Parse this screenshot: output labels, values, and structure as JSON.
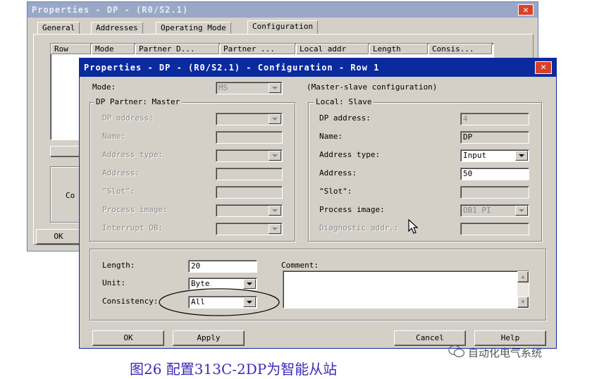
{
  "back_window": {
    "title": "Properties - DP - (R0/S2.1)",
    "tabs": [
      "General",
      "Addresses",
      "Operating Mode",
      "Configuration"
    ],
    "active_tab": "Configuration",
    "columns": [
      "Row",
      "Mode",
      "Partner D...",
      "Partner ...",
      "Local addr",
      "Length",
      "Consis..."
    ],
    "partial_label": "Co",
    "ok_label": "OK"
  },
  "dialog": {
    "title": "Properties - DP - (R0/S2.1) - Configuration - Row 1",
    "mode_label": "Mode:",
    "mode_value": "MS",
    "mode_description": "(Master-slave configuration)",
    "partner": {
      "group_label": "DP Partner: Master",
      "dp_address_label": "DP address:",
      "name_label": "Name:",
      "address_type_label": "Address type:",
      "address_label": "Address:",
      "slot_label": "\"Slot\":",
      "process_image_label": "Process image:",
      "interrupt_ob_label": "Interrupt OB:"
    },
    "local": {
      "group_label": "Local: Slave",
      "dp_address_label": "DP address:",
      "dp_address_value": "4",
      "name_label": "Name:",
      "name_value": "DP",
      "address_type_label": "Address type:",
      "address_type_value": "Input",
      "address_label": "Address:",
      "address_value": "50",
      "slot_label": "\"Slot\":",
      "process_image_label": "Process image:",
      "process_image_value": "OB1 PI",
      "diagnostic_label": "Diagnostic addr.:"
    },
    "length_label": "Length:",
    "length_value": "20",
    "unit_label": "Unit:",
    "unit_value": "Byte",
    "consistency_label": "Consistency:",
    "consistency_value": "All",
    "comment_label": "Comment:",
    "comment_value": "",
    "buttons": {
      "ok": "OK",
      "apply": "Apply",
      "cancel": "Cancel",
      "help": "Help"
    }
  },
  "caption": "图26   配置313C-2DP为智能从站",
  "watermark": "自动化电气系统"
}
